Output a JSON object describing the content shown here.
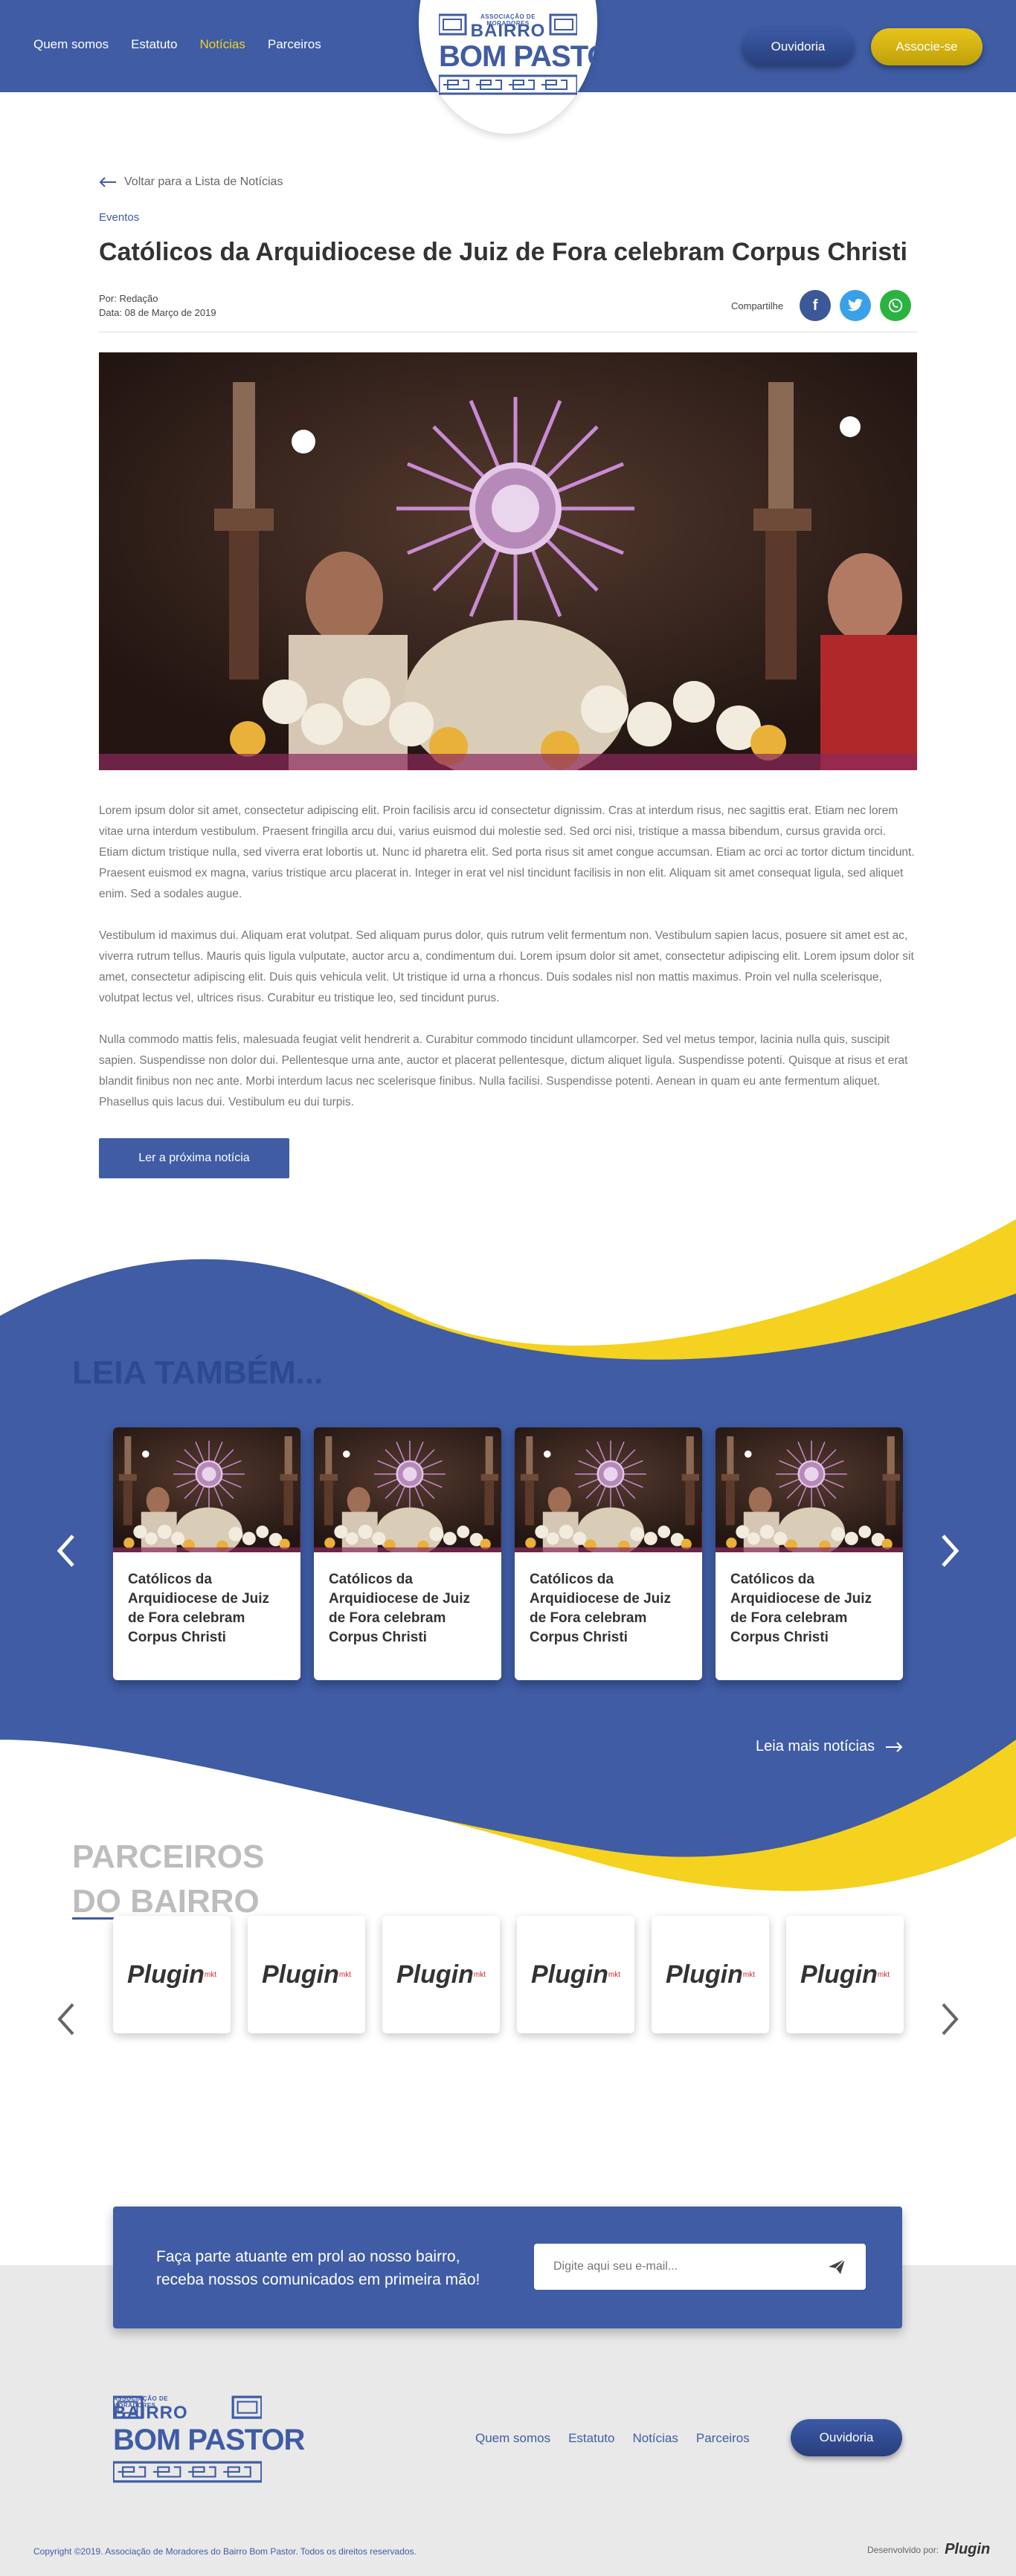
{
  "header": {
    "nav": [
      "Quem somos",
      "Estatuto",
      "Notícias",
      "Parceiros"
    ],
    "active_nav": "Notícias",
    "logo_small": "ASSOCIAÇÃO DE MORADORES",
    "logo_line1": "BAIRRO",
    "logo_line2": "BOM PASTOR",
    "ouvidoria": "Ouvidoria",
    "associe": "Associe-se"
  },
  "article": {
    "back": "Voltar para a Lista de Notícias",
    "category": "Eventos",
    "title": "Católicos da Arquidiocese de Juiz de Fora celebram Corpus Christi",
    "author": "Por: Redação",
    "date": "Data: 08 de Março de 2019",
    "share_label": "Compartilhe",
    "paragraphs": [
      "Lorem ipsum dolor sit amet, consectetur adipiscing elit. Proin facilisis arcu id consectetur dignissim. Cras at interdum risus, nec sagittis erat. Etiam nec lorem vitae urna interdum vestibulum. Praesent fringilla arcu dui, varius euismod dui molestie sed. Sed orci nisi, tristique a massa bibendum, cursus gravida orci. Etiam dictum tristique nulla, sed viverra erat lobortis ut. Nunc id pharetra elit. Sed porta risus sit amet congue accumsan. Etiam ac orci ac tortor dictum tincidunt. Praesent euismod ex magna, varius tristique arcu placerat in. Integer in erat vel nisl tincidunt facilisis in non elit. Aliquam sit amet consequat ligula, sed aliquet enim. Sed a sodales augue.",
      "Vestibulum id maximus dui. Aliquam erat volutpat. Sed aliquam purus dolor, quis rutrum velit fermentum non. Vestibulum sapien lacus, posuere sit amet est ac, viverra rutrum tellus. Mauris quis ligula vulputate, auctor arcu a, condimentum dui. Lorem ipsum dolor sit amet, consectetur adipiscing elit. Lorem ipsum dolor sit amet, consectetur adipiscing elit. Duis quis vehicula velit. Ut tristique id urna a rhoncus. Duis sodales nisl non mattis maximus. Proin vel nulla scelerisque, volutpat lectus vel, ultrices risus. Curabitur eu tristique leo, sed tincidunt purus.",
      "Nulla commodo mattis felis, malesuada feugiat velit hendrerit a. Curabitur commodo tincidunt ullamcorper. Sed vel metus tempor, lacinia nulla quis, suscipit sapien. Suspendisse non dolor dui. Pellentesque urna ante, auctor et placerat pellentesque, dictum aliquet ligula. Suspendisse potenti. Quisque at risus et erat blandit finibus non nec ante. Morbi interdum lacus nec scelerisque finibus. Nulla facilisi. Suspendisse potenti. Aenean in quam eu ante fermentum aliquet. Phasellus quis lacus dui. Vestibulum eu dui turpis."
    ],
    "next": "Ler a próxima notícia"
  },
  "related": {
    "title": "LEIA TAMBÉM...",
    "cards": [
      {
        "title": "Católicos da Arquidiocese de Juiz de Fora celebram Corpus Christi"
      },
      {
        "title": "Católicos da Arquidiocese de Juiz de Fora celebram Corpus Christi"
      },
      {
        "title": "Católicos da Arquidiocese de Juiz de Fora celebram Corpus Christi"
      },
      {
        "title": "Católicos da Arquidiocese de Juiz de Fora celebram Corpus Christi"
      }
    ],
    "more": "Leia mais notícias"
  },
  "partners": {
    "title_line1": "PARCEIROS",
    "title_line2": "DO BAIRRO",
    "logos": [
      {
        "name": "Plugin",
        "sub": "mkt"
      },
      {
        "name": "Plugin",
        "sub": "mkt"
      },
      {
        "name": "Plugin",
        "sub": "mkt"
      },
      {
        "name": "Plugin",
        "sub": "mkt"
      },
      {
        "name": "Plugin",
        "sub": "mkt"
      },
      {
        "name": "Plugin",
        "sub": "mkt"
      }
    ]
  },
  "newsletter": {
    "line1": "Faça parte atuante em prol ao nosso bairro,",
    "line2": "receba nossos comunicados em primeira mão!",
    "placeholder": "Digite aqui seu e-mail..."
  },
  "footer": {
    "nav": [
      "Quem somos",
      "Estatuto",
      "Notícias",
      "Parceiros"
    ],
    "ouvidoria": "Ouvidoria",
    "copyright": "Copyright ©2019. Associação de Moradores do Bairro Bom Pastor. Todos os direitos reservados.",
    "developed_by": "Desenvolvido por:",
    "dev_brand": "Plugin"
  },
  "colors": {
    "primary": "#3f5ca4",
    "accent": "#f4d21f",
    "muted": "#bdbdbd",
    "footer_bg": "#e9e9e9"
  }
}
